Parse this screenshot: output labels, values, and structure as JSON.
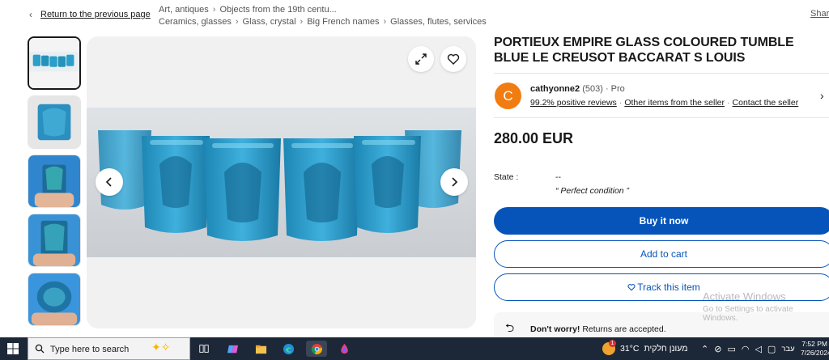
{
  "nav": {
    "back_label": "Return to the previous page",
    "breadcrumbs_row1": [
      "Art, antiques",
      "Objects from the 19th centu..."
    ],
    "breadcrumbs_row2": [
      "Ceramics, glasses",
      "Glass, crystal",
      "Big French names",
      "Glasses, flutes, services"
    ],
    "share_label": "Share"
  },
  "listing": {
    "title": "PORTIEUX EMPIRE GLASS COLOURED TUMBLE BLUE LE CREUSOT BACCARAT S LOUIS",
    "price": "280.00 EUR",
    "condition_label": "State :",
    "condition_value": "--",
    "condition_quote": "“ Perfect condition ”"
  },
  "seller": {
    "avatar_letter": "C",
    "name": "cathyonne2",
    "rating_count": "(503)",
    "badge": "· Pro",
    "positive": "99.2% positive reviews",
    "other_items": "Other items from the seller",
    "contact": "Contact the seller"
  },
  "actions": {
    "buy_label": "Buy it now",
    "cart_label": "Add to cart",
    "watch_label": "Track this item"
  },
  "returns": {
    "bold": "Don't worry!",
    "text": " Returns are accepted."
  },
  "watermark": {
    "line1": "Activate Windows",
    "line2": "Go to Settings to activate Windows."
  },
  "taskbar": {
    "search_placeholder": "Type here to search",
    "weather_temp": "31°C",
    "weather_text": "מעונן חלקית",
    "notif_count": "1",
    "lang": "עבר",
    "time": "7:52 PM",
    "date": "7/26/2024"
  },
  "colors": {
    "accent": "#0654ba",
    "avatar": "#f07c12",
    "glass": "#2a9fc9",
    "taskbar": "#1c2738"
  },
  "icons": [
    "chevron-left-icon",
    "expand-icon",
    "heart-icon",
    "chevron-right-icon",
    "heart-outline-icon",
    "return-icon",
    "windows-logo-icon",
    "search-icon"
  ]
}
